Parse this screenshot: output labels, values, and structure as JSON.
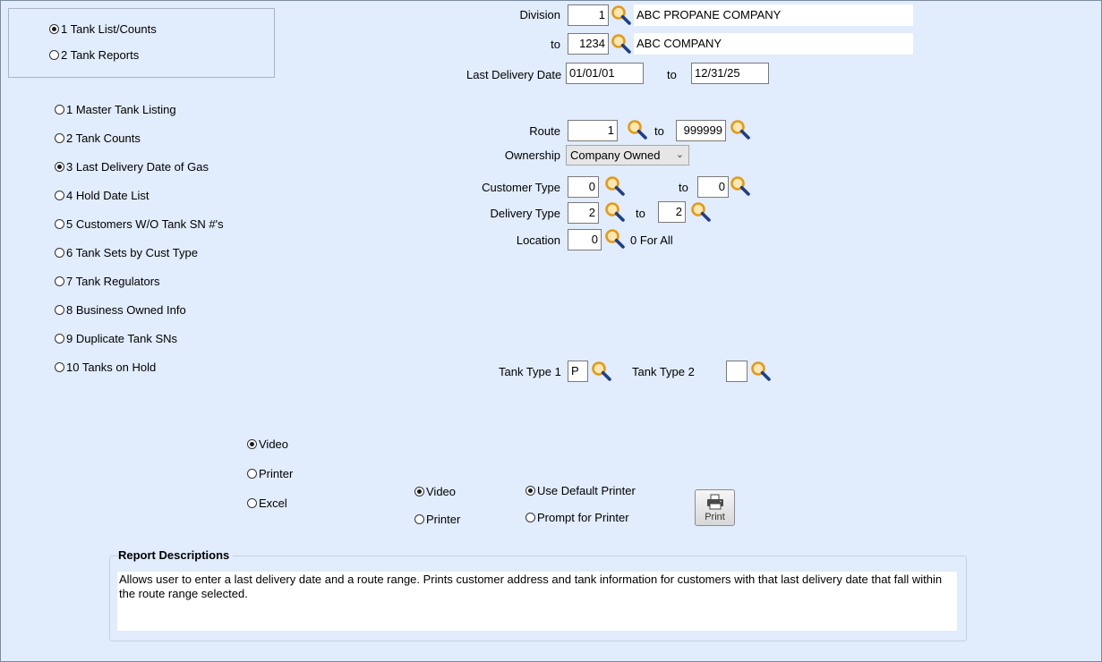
{
  "report_group": {
    "options": [
      {
        "label": "1 Tank List/Counts",
        "selected": true
      },
      {
        "label": "2 Tank Reports",
        "selected": false
      }
    ]
  },
  "report_list": [
    {
      "label": "1 Master Tank Listing",
      "selected": false
    },
    {
      "label": "2 Tank Counts",
      "selected": false
    },
    {
      "label": "3 Last Delivery Date of Gas",
      "selected": true
    },
    {
      "label": "4 Hold Date List",
      "selected": false
    },
    {
      "label": "5 Customers W/O Tank SN #'s",
      "selected": false
    },
    {
      "label": "6 Tank Sets by Cust Type",
      "selected": false
    },
    {
      "label": "7 Tank Regulators",
      "selected": false
    },
    {
      "label": "8 Business Owned Info",
      "selected": false
    },
    {
      "label": "9 Duplicate Tank SNs",
      "selected": false
    },
    {
      "label": "10 Tanks on Hold",
      "selected": false
    }
  ],
  "division": {
    "label": "Division",
    "from": "1",
    "from_name": "ABC PROPANE COMPANY",
    "to_label": "to",
    "to": "1234",
    "to_name": "ABC COMPANY"
  },
  "last_delivery": {
    "label": "Last Delivery Date",
    "from": "01/01/01",
    "to_label": "to",
    "to": "12/31/25"
  },
  "route": {
    "label": "Route",
    "from": "1",
    "to_label": "to",
    "to": "999999"
  },
  "ownership": {
    "label": "Ownership",
    "value": "Company Owned"
  },
  "customer_type": {
    "label": "Customer Type",
    "from": "0",
    "to_label": "to",
    "to": "0"
  },
  "delivery_type": {
    "label": "Delivery Type",
    "from": "2",
    "to_label": "to",
    "to": "2"
  },
  "location": {
    "label": "Location",
    "value": "0",
    "hint": "0 For All"
  },
  "tank_type": {
    "label1": "Tank Type 1",
    "value1": "P",
    "label2": "Tank Type 2",
    "value2": ""
  },
  "output": {
    "options": [
      {
        "label": "Video",
        "selected": true
      },
      {
        "label": "Printer",
        "selected": false
      },
      {
        "label": "Excel",
        "selected": false
      }
    ]
  },
  "output2": {
    "options": [
      {
        "label": "Video",
        "selected": true
      },
      {
        "label": "Printer",
        "selected": false
      }
    ]
  },
  "printer_choice": {
    "options": [
      {
        "label": "Use Default Printer",
        "selected": true
      },
      {
        "label": "Prompt for Printer",
        "selected": false
      }
    ]
  },
  "print_button": {
    "label": "Print"
  },
  "description": {
    "title": "Report Descriptions",
    "text": "Allows user to enter a last delivery date and a route range. Prints customer address and tank information for customers with that last delivery date that fall within the route range selected."
  },
  "colors": {
    "background": "#e1ecfc",
    "magnifier": "#e39b17"
  },
  "icons": [
    "search-icon",
    "printer-icon"
  ]
}
